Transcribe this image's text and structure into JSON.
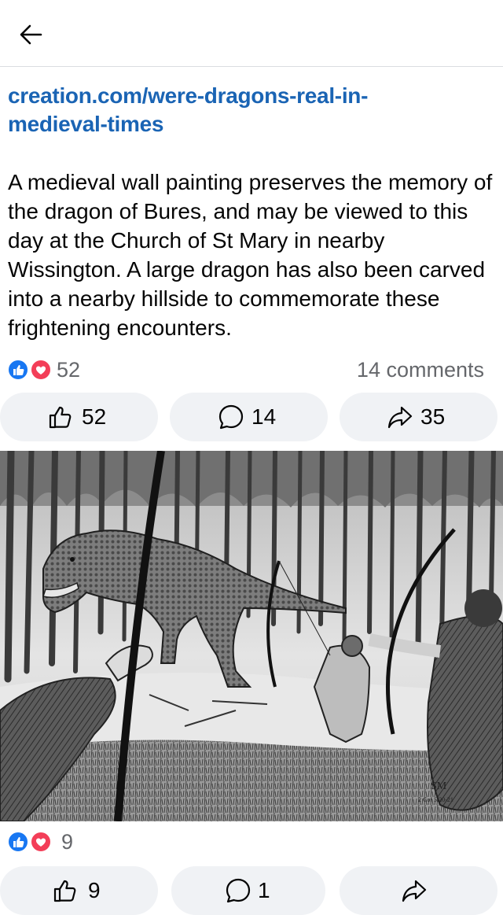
{
  "header": {
    "back_icon": "arrow-left-icon"
  },
  "post": {
    "link_text": "creation.com/were-dragons-real-in-medieval-times",
    "link_line1": "creation.com/were-dragons-real-in-",
    "link_line2": "medieval-times",
    "description": "A medieval wall painting preserves the memory of the dragon of Bures, and may be viewed to this day at the Church of St Mary in nearby Wissington. A large dragon has also been carved into a nearby hillside to commemorate these frightening encounters.",
    "reaction_count": "52",
    "comments_label": "14 comments",
    "actions": {
      "like_count": "52",
      "comment_count": "14",
      "share_count": "35"
    }
  },
  "photo": {
    "signature": "SM",
    "verse_ref": "2 Cor 5:20-21",
    "reaction_count": "9",
    "actions": {
      "like_count": "9",
      "comment_count": "1"
    }
  },
  "colors": {
    "link": "#1a64b4",
    "like_blue": "#1877f2",
    "love_red": "#f33e58",
    "button_bg": "#f0f2f5",
    "secondary_text": "#65676b"
  }
}
